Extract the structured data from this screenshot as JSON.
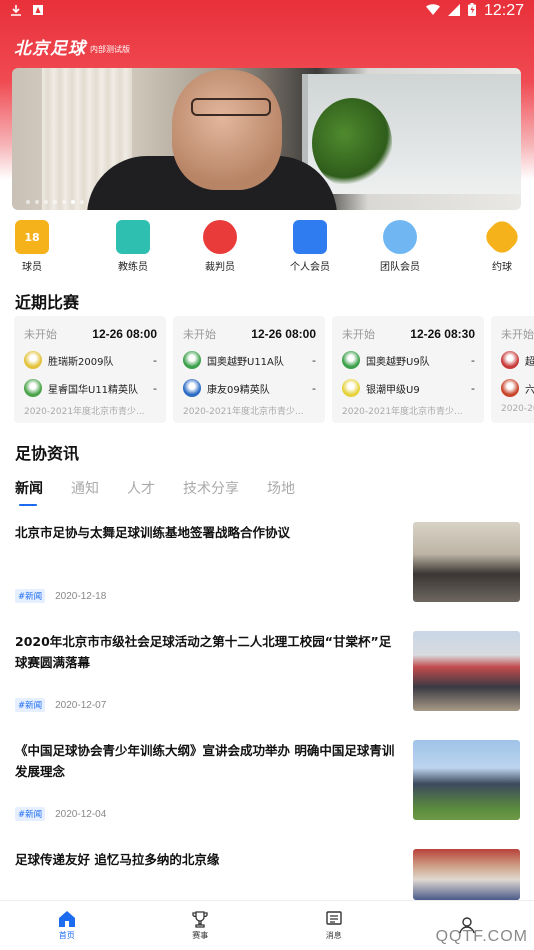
{
  "status_bar": {
    "time": "12:27"
  },
  "header": {
    "title": "北京足球",
    "badge": "内部测试版"
  },
  "quick_links": [
    {
      "label": "球员",
      "icon": "jersey-icon",
      "color": "#f5b21b",
      "glyph": "18"
    },
    {
      "label": "教练员",
      "icon": "tactics-board-icon",
      "color": "#2fbfb0",
      "glyph": ""
    },
    {
      "label": "裁判员",
      "icon": "whistle-icon",
      "color": "#ea3b3b",
      "glyph": ""
    },
    {
      "label": "个人会员",
      "icon": "person-badge-icon",
      "color": "#2f7bf0",
      "glyph": ""
    },
    {
      "label": "团队会员",
      "icon": "team-icon",
      "color": "#6fb6f2",
      "glyph": ""
    },
    {
      "label": "约球",
      "icon": "ball-icon",
      "color": "#f5b21b",
      "glyph": ""
    }
  ],
  "recent_matches": {
    "title": "近期比赛",
    "cards": [
      {
        "status": "未开始",
        "time": "12-26 08:00",
        "home": {
          "name": "胜瑞斯2009队",
          "score": "-",
          "logo_color": "#e3c23a"
        },
        "away": {
          "name": "星睿国华U11精英队",
          "score": "-",
          "logo_color": "#4aa34a"
        },
        "league": "2020-2021年度北京市青少..."
      },
      {
        "status": "未开始",
        "time": "12-26 08:00",
        "home": {
          "name": "国奥越野U11A队",
          "score": "-",
          "logo_color": "#3aa049"
        },
        "away": {
          "name": "康友09精英队",
          "score": "-",
          "logo_color": "#2b6bc4"
        },
        "league": "2020-2021年度北京市青少..."
      },
      {
        "status": "未开始",
        "time": "12-26 08:30",
        "home": {
          "name": "国奥越野U9队",
          "score": "-",
          "logo_color": "#3aa049"
        },
        "away": {
          "name": "银潮甲级U9",
          "score": "-",
          "logo_color": "#e6d23a"
        },
        "league": "2020-2021年度北京市青少..."
      },
      {
        "status": "未开始",
        "time": "",
        "home": {
          "name": "超",
          "score": "",
          "logo_color": "#c83a3a"
        },
        "away": {
          "name": "六",
          "score": "",
          "logo_color": "#c8452a"
        },
        "league": "2020-20"
      }
    ]
  },
  "news": {
    "title": "足协资讯",
    "tabs": [
      "新闻",
      "通知",
      "人才",
      "技术分享",
      "场地"
    ],
    "items": [
      {
        "title": "北京市足协与太舞足球训练基地签署战略合作协议",
        "tag": "#新闻",
        "date": "2020-12-18"
      },
      {
        "title": "2020年北京市市级社会足球活动之第十二人北理工校园“甘棠杯”足球赛圆满落幕",
        "tag": "#新闻",
        "date": "2020-12-07"
      },
      {
        "title": "《中国足球协会青少年训练大纲》宣讲会成功举办 明确中国足球青训发展理念",
        "tag": "#新闻",
        "date": "2020-12-04"
      },
      {
        "title": "足球传递友好 追忆马拉多纳的北京缘",
        "tag": "",
        "date": ""
      }
    ]
  },
  "bottom_nav": [
    {
      "label": "首页",
      "icon": "home-icon",
      "active": true
    },
    {
      "label": "赛事",
      "icon": "trophy-icon",
      "active": false
    },
    {
      "label": "消息",
      "icon": "message-icon",
      "active": false
    },
    {
      "label": "",
      "icon": "profile-icon",
      "active": false
    }
  ],
  "watermark": "QQTF.COM",
  "colors": {
    "brand_red": "#e8303a",
    "accent_blue": "#1d6cf0"
  }
}
